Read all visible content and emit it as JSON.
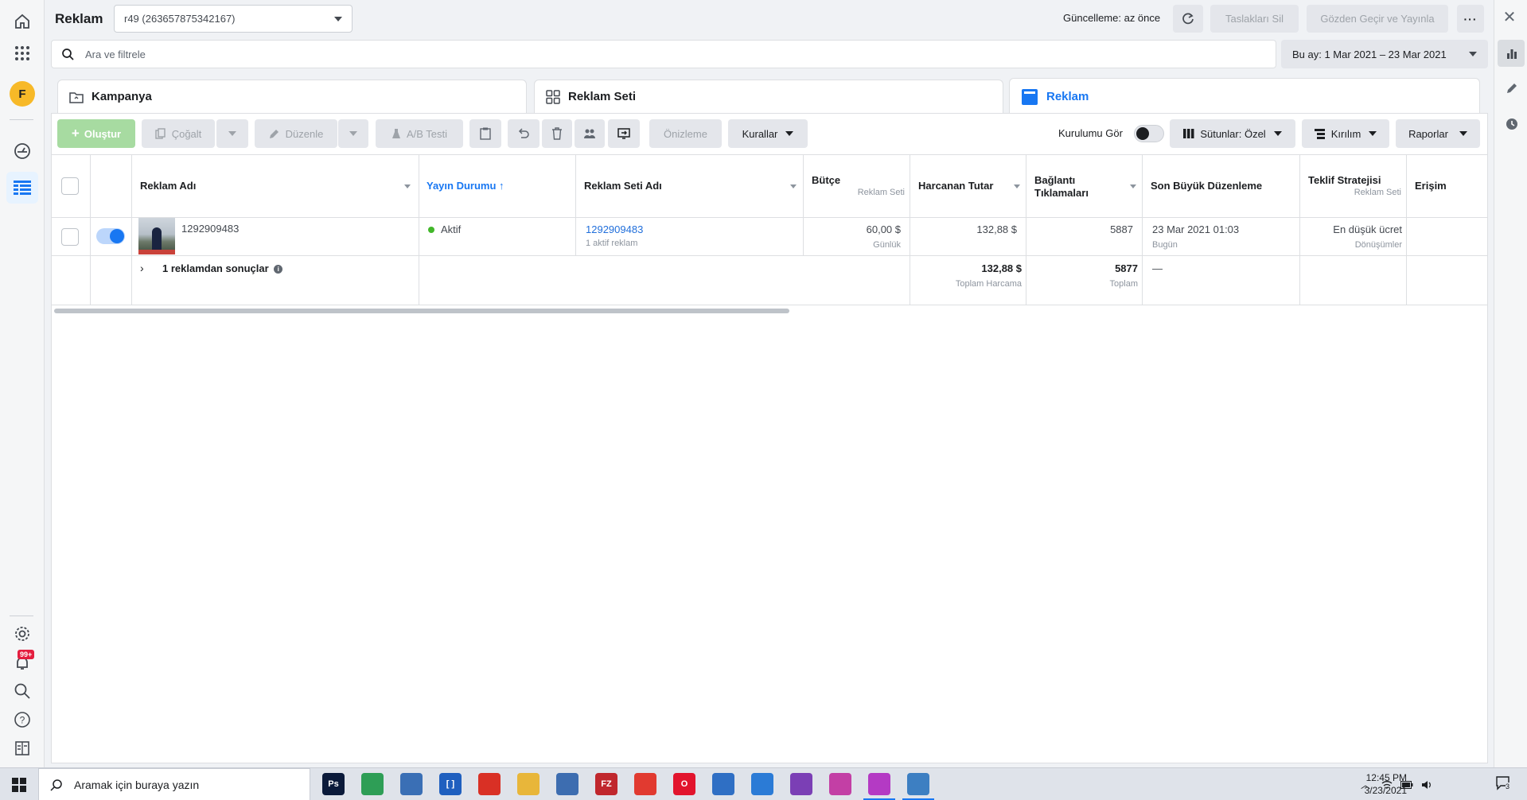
{
  "header": {
    "title": "Reklam",
    "account": "r49 (263657875342167)",
    "update_status": "Güncelleme: az önce",
    "delete_drafts": "Taslakları Sil",
    "review_publish": "Gözden Geçir ve Yayınla",
    "more": "···"
  },
  "search": {
    "placeholder": "Ara ve filtrele",
    "date_range": "Bu ay: 1 Mar 2021 – 23 Mar 2021"
  },
  "tabs": [
    {
      "label": "Kampanya",
      "icon": "folder-icon"
    },
    {
      "label": "Reklam Seti",
      "icon": "grid-icon"
    },
    {
      "label": "Reklam",
      "icon": "ad-icon",
      "active": true
    }
  ],
  "toolbar": {
    "create": "Oluştur",
    "duplicate": "Çoğalt",
    "edit": "Düzenle",
    "ab_test": "A/B Testi",
    "preview": "Önizleme",
    "rules": "Kurallar",
    "setup_toggle_label": "Kurulumu Gör",
    "columns": "Sütunlar: Özel",
    "breakdown": "Kırılım",
    "reports": "Raporlar"
  },
  "table": {
    "headers": {
      "ad_name": "Reklam Adı",
      "delivery": "Yayın Durumu ↑",
      "adset_name": "Reklam Seti Adı",
      "budget": "Bütçe",
      "budget_sub": "Reklam Seti",
      "spent": "Harcanan Tutar",
      "link_clicks_1": "Bağlantı",
      "link_clicks_2": "Tıklamaları",
      "last_edit": "Son Büyük Düzenleme",
      "bid_strategy": "Teklif Stratejisi",
      "bid_sub": "Reklam Seti",
      "reach": "Erişim"
    },
    "row": {
      "name": "1292909483",
      "status": "Aktif",
      "adset": "1292909483",
      "adset_sub": "1 aktif reklam",
      "budget": "60,00 $",
      "budget_sub": "Günlük",
      "spent": "132,88 $",
      "clicks": "5887",
      "last_edit": "23 Mar 2021 01:03",
      "last_edit_sub": "Bugün",
      "bid": "En düşük ücret",
      "bid_sub": "Dönüşümler"
    },
    "summary": {
      "label": "1 reklamdan sonuçlar",
      "spent": "132,88 $",
      "spent_sub": "Toplam Harcama",
      "clicks": "5877",
      "clicks_sub": "Toplam",
      "last_edit": "—"
    }
  },
  "leftnav": {
    "avatar": "F",
    "badge": "99+"
  },
  "taskbar": {
    "search_placeholder": "Aramak için buraya yazın",
    "time": "12:45 PM",
    "date": "3/23/2021",
    "notif_count": "3",
    "apps": [
      {
        "name": "photoshop-icon",
        "label": "Ps",
        "color": "#0b1a3a"
      },
      {
        "name": "maps-icon",
        "label": "",
        "color": "#2e9e56"
      },
      {
        "name": "network-icon",
        "label": "",
        "color": "#3a6fb5"
      },
      {
        "name": "bracket-app-icon",
        "label": "[ ]",
        "color": "#1f5fbf"
      },
      {
        "name": "chrome-icon",
        "label": "",
        "color": "#d93025"
      },
      {
        "name": "folder-icon",
        "label": "",
        "color": "#e8b63a"
      },
      {
        "name": "remote-icon",
        "label": "",
        "color": "#3d6db0"
      },
      {
        "name": "filezilla-icon",
        "label": "FZ",
        "color": "#c0272d"
      },
      {
        "name": "anydesk-icon",
        "label": "",
        "color": "#e13a30"
      },
      {
        "name": "opera-icon",
        "label": "O",
        "color": "#e2142d"
      },
      {
        "name": "thunderbird-icon",
        "label": "",
        "color": "#2f6fc4"
      },
      {
        "name": "firefox-icon",
        "label": "",
        "color": "#2b7bd6"
      },
      {
        "name": "monster-icon",
        "label": "",
        "color": "#7b3fb5"
      },
      {
        "name": "swirl-app-icon",
        "label": "",
        "color": "#c33fa5"
      },
      {
        "name": "swirl-app-2-icon",
        "label": "",
        "color": "#b43ac4"
      },
      {
        "name": "photos-icon",
        "label": "",
        "color": "#3d7fc2"
      }
    ]
  },
  "colors": {
    "accent": "#1877f2",
    "active_green": "#42b72a",
    "create_button": "#a7dba1"
  }
}
